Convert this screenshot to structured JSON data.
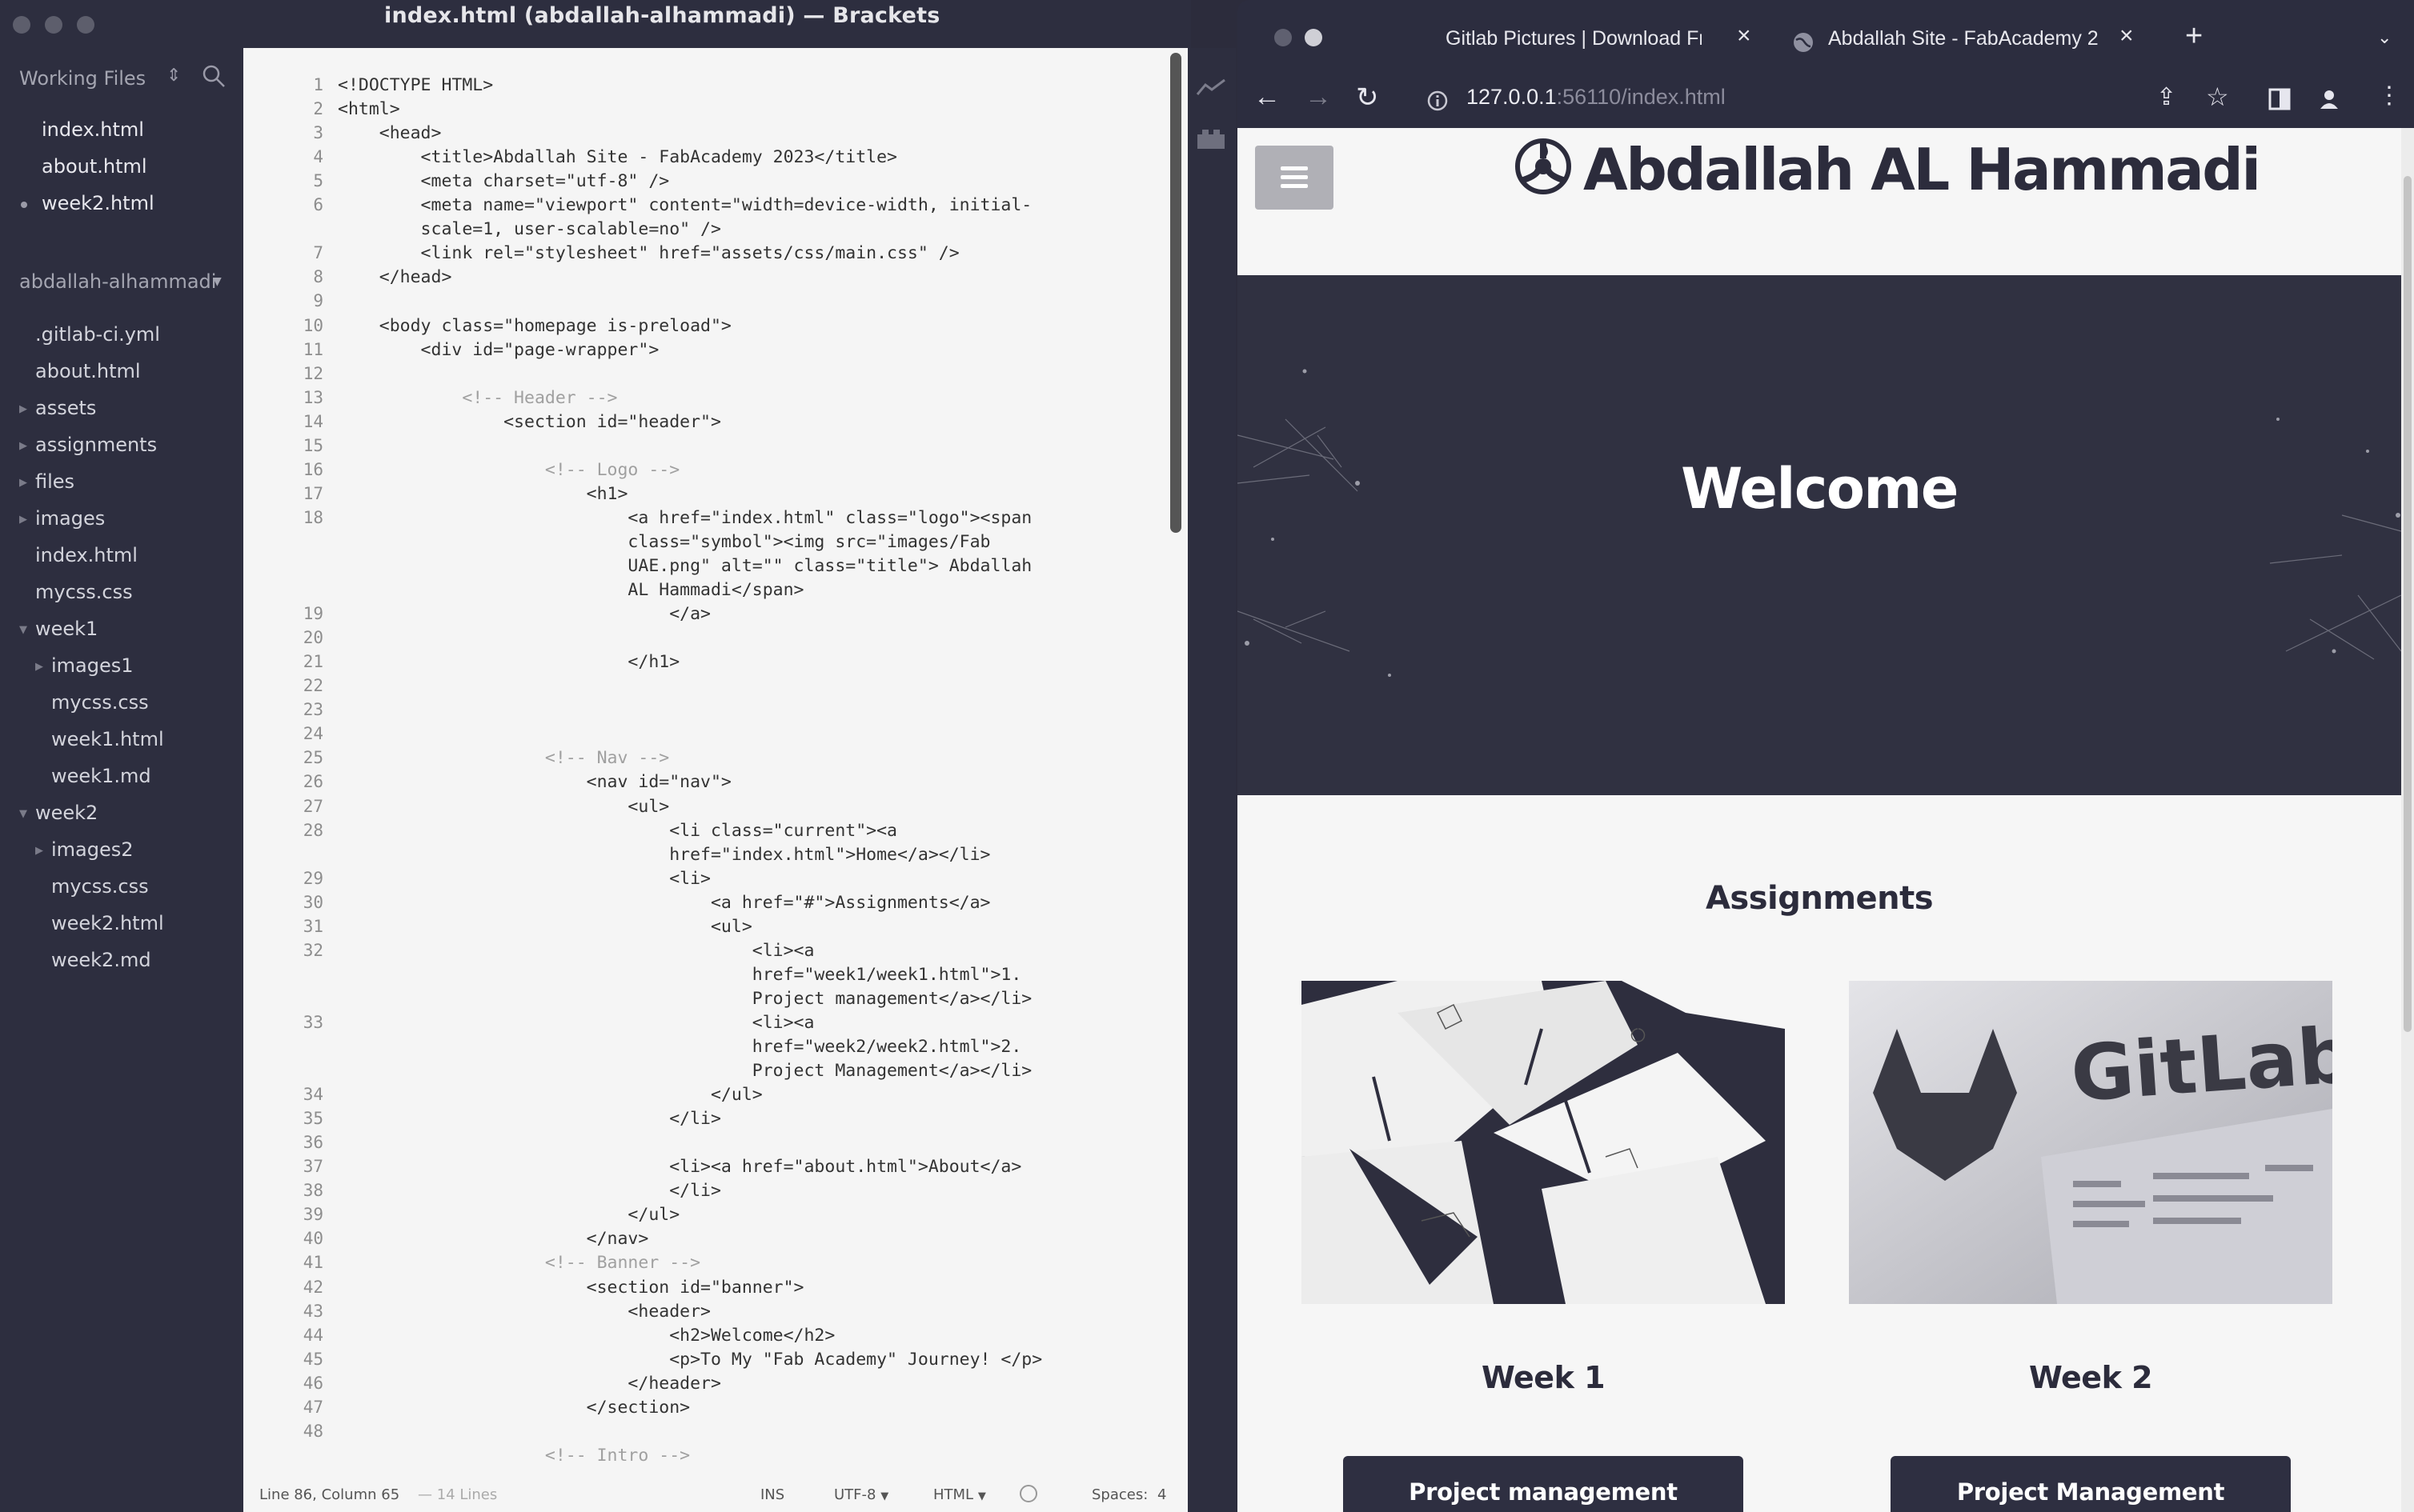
{
  "editor_window": {
    "title": "index.html (abdallah-alhammadi) — Brackets"
  },
  "sidebar": {
    "working_files_label": "Working Files",
    "working_files": [
      {
        "name": "index.html",
        "modified": false
      },
      {
        "name": "about.html",
        "modified": false
      },
      {
        "name": "week2.html",
        "modified": true
      }
    ],
    "project_name": "abdallah-alhammadi",
    "tree": [
      {
        "name": ".gitlab-ci.yml",
        "type": "file",
        "depth": 0
      },
      {
        "name": "about.html",
        "type": "file",
        "depth": 0
      },
      {
        "name": "assets",
        "type": "folder-closed",
        "depth": 0
      },
      {
        "name": "assignments",
        "type": "folder-closed",
        "depth": 0
      },
      {
        "name": "files",
        "type": "folder-closed",
        "depth": 0
      },
      {
        "name": "images",
        "type": "folder-closed",
        "depth": 0
      },
      {
        "name": "index.html",
        "type": "file",
        "depth": 0
      },
      {
        "name": "mycss.css",
        "type": "file",
        "depth": 0
      },
      {
        "name": "week1",
        "type": "folder-open",
        "depth": 0
      },
      {
        "name": "images1",
        "type": "folder-closed",
        "depth": 1
      },
      {
        "name": "mycss.css",
        "type": "file",
        "depth": 1
      },
      {
        "name": "week1.html",
        "type": "file",
        "depth": 1
      },
      {
        "name": "week1.md",
        "type": "file",
        "depth": 1
      },
      {
        "name": "week2",
        "type": "folder-open",
        "depth": 0
      },
      {
        "name": "images2",
        "type": "folder-closed",
        "depth": 1
      },
      {
        "name": "mycss.css",
        "type": "file",
        "depth": 1
      },
      {
        "name": "week2.html",
        "type": "file",
        "depth": 1
      },
      {
        "name": "week2.md",
        "type": "file",
        "depth": 1
      }
    ]
  },
  "code": {
    "line_numbers": [
      "1",
      "2",
      "3",
      "4",
      "5",
      "6",
      "7",
      "8",
      "9",
      "10",
      "11",
      "12",
      "13",
      "14",
      "15",
      "16",
      "17",
      "18",
      "19",
      "20",
      "21",
      "22",
      "23",
      "24",
      "25",
      "26",
      "27",
      "28",
      "29",
      "30",
      "31",
      "32",
      "33",
      "34",
      "35",
      "36",
      "37",
      "38",
      "39",
      "40",
      "41",
      "42",
      "43",
      "44",
      "45",
      "46",
      "47",
      "48"
    ],
    "lines": [
      {
        "text": "<!DOCTYPE HTML>",
        "comment": false
      },
      {
        "text": "<html>",
        "comment": false
      },
      {
        "text": "    <head>",
        "comment": false
      },
      {
        "text": "        <title>Abdallah Site - FabAcademy 2023</title>",
        "comment": false
      },
      {
        "text": "        <meta charset=\"utf-8\" />",
        "comment": false
      },
      {
        "text": "        <meta name=\"viewport\" content=\"width=device-width, initial-",
        "comment": false
      },
      {
        "text": "        scale=1, user-scalable=no\" />",
        "comment": false
      },
      {
        "text": "        <link rel=\"stylesheet\" href=\"assets/css/main.css\" />",
        "comment": false
      },
      {
        "text": "    </head>",
        "comment": false
      },
      {
        "text": "",
        "comment": false
      },
      {
        "text": "    <body class=\"homepage is-preload\">",
        "comment": false
      },
      {
        "text": "        <div id=\"page-wrapper\">",
        "comment": false
      },
      {
        "text": "",
        "comment": false
      },
      {
        "text": "            <!-- Header -->",
        "comment": true
      },
      {
        "text": "                <section id=\"header\">",
        "comment": false
      },
      {
        "text": "",
        "comment": false
      },
      {
        "text": "                    <!-- Logo -->",
        "comment": true
      },
      {
        "text": "                        <h1>",
        "comment": false
      },
      {
        "text": "                            <a href=\"index.html\" class=\"logo\"><span",
        "comment": false
      },
      {
        "text": "                            class=\"symbol\"><img src=\"images/Fab",
        "comment": false
      },
      {
        "text": "                            UAE.png\" alt=\"\" class=\"title\"> Abdallah",
        "comment": false
      },
      {
        "text": "                            AL Hammadi</span>",
        "comment": false
      },
      {
        "text": "                                </a>",
        "comment": false
      },
      {
        "text": "",
        "comment": false
      },
      {
        "text": "                            </h1>",
        "comment": false
      },
      {
        "text": "",
        "comment": false
      },
      {
        "text": "",
        "comment": false
      },
      {
        "text": "",
        "comment": false
      },
      {
        "text": "                    <!-- Nav -->",
        "comment": true
      },
      {
        "text": "                        <nav id=\"nav\">",
        "comment": false
      },
      {
        "text": "                            <ul>",
        "comment": false
      },
      {
        "text": "                                <li class=\"current\"><a",
        "comment": false
      },
      {
        "text": "                                href=\"index.html\">Home</a></li>",
        "comment": false
      },
      {
        "text": "                                <li>",
        "comment": false
      },
      {
        "text": "                                    <a href=\"#\">Assignments</a>",
        "comment": false
      },
      {
        "text": "                                    <ul>",
        "comment": false
      },
      {
        "text": "                                        <li><a",
        "comment": false
      },
      {
        "text": "                                        href=\"week1/week1.html\">1.",
        "comment": false
      },
      {
        "text": "                                        Project management</a></li>",
        "comment": false
      },
      {
        "text": "                                        <li><a",
        "comment": false
      },
      {
        "text": "                                        href=\"week2/week2.html\">2.",
        "comment": false
      },
      {
        "text": "                                        Project Management</a></li>",
        "comment": false
      },
      {
        "text": "                                    </ul>",
        "comment": false
      },
      {
        "text": "                                </li>",
        "comment": false
      },
      {
        "text": "",
        "comment": false
      },
      {
        "text": "                                <li><a href=\"about.html\">About</a>",
        "comment": false
      },
      {
        "text": "                                </li>",
        "comment": false
      },
      {
        "text": "                            </ul>",
        "comment": false
      },
      {
        "text": "                        </nav>",
        "comment": false
      },
      {
        "text": "                    <!-- Banner -->",
        "comment": true
      },
      {
        "text": "                        <section id=\"banner\">",
        "comment": false
      },
      {
        "text": "                            <header>",
        "comment": false
      },
      {
        "text": "                                <h2>Welcome</h2>",
        "comment": false
      },
      {
        "text": "                                <p>To My \"Fab Academy\" Journey! </p>",
        "comment": false
      },
      {
        "text": "                            </header>",
        "comment": false
      },
      {
        "text": "                        </section>",
        "comment": false
      },
      {
        "text": "",
        "comment": false
      },
      {
        "text": "                    <!-- Intro -->",
        "comment": true
      }
    ]
  },
  "statusbar": {
    "position": "Line 86, Column 65",
    "lines": "— 14 Lines",
    "mode": "INS",
    "encoding": "UTF-8",
    "language": "HTML",
    "spaces_label": "Spaces:",
    "spaces_value": "4"
  },
  "browser": {
    "tabs": [
      {
        "title": "Gitlab Pictures | Download Fre",
        "active": false
      },
      {
        "title": "Abdallah Site - FabAcademy 2",
        "active": true
      }
    ],
    "url_host": "127.0.0.1",
    "url_rest": ":56110/index.html"
  },
  "site": {
    "title": "Abdallah AL Hammadi",
    "banner_heading": "Welcome",
    "assignments_heading": "Assignments",
    "cards": [
      {
        "label": "Week 1",
        "button": "Project management"
      },
      {
        "label": "Week 2",
        "button": "Project Management"
      }
    ],
    "gitlab_image_text": "GitLab"
  },
  "colors": {
    "sidebar_bg": "#2d2e3f",
    "editor_bg": "#f5f5f5",
    "browser_chrome": "#2c2d3f",
    "banner_bg": "#303141",
    "button_bg": "#2e2f41"
  }
}
